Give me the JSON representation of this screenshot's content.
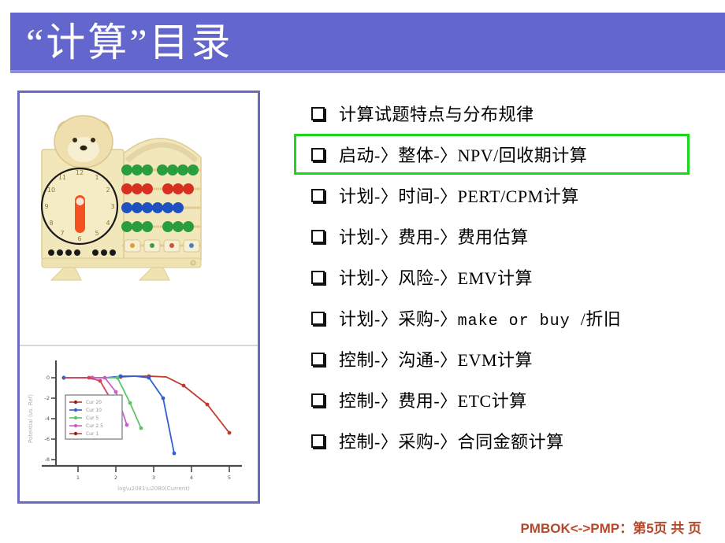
{
  "slide": {
    "title": "“计算”目录",
    "banner_color": "#6366cc",
    "highlight_color": "#19d819",
    "frame_color": "#6a6bc0"
  },
  "bullets": [
    {
      "label": "计算试题特点与分布规律",
      "highlighted": false
    },
    {
      "label": "启动-〉整体-〉NPV/回收期计算",
      "highlighted": true
    },
    {
      "label": "计划-〉时间-〉PERT/CPM计算",
      "highlighted": false
    },
    {
      "label": "计划-〉费用-〉费用估算",
      "highlighted": false
    },
    {
      "label": "计划-〉风险-〉EMV计算",
      "highlighted": false
    },
    {
      "label": "计划-〉采购-〉",
      "mono": "make or buy ",
      "label_tail": "/折旧",
      "highlighted": false
    },
    {
      "label": "控制-〉沟通-〉EVM计算",
      "highlighted": false
    },
    {
      "label": "控制-〉费用-〉ETC计算",
      "highlighted": false
    },
    {
      "label": "控制-〉采购-〉合同金额计算",
      "highlighted": false
    }
  ],
  "footer": {
    "text": "PMBOK<->PMP：第5页 共 页",
    "color": "#b5472a"
  },
  "left_photo": {
    "name": "wooden-bear-abacus-clock-toy",
    "description": "木制小熊时钟算盘玩具",
    "wood_color": "#f0e4b4",
    "bead_colors": [
      "#2a9d3f",
      "#d83020",
      "#1f52c0",
      "#2a9d3f"
    ],
    "clock_numbers": [
      "12",
      "1",
      "2",
      "3",
      "4",
      "5",
      "6",
      "7",
      "8",
      "9",
      "10",
      "11"
    ],
    "clock_hand_color": "#f4511e"
  },
  "chart_data": {
    "type": "line",
    "title": "",
    "xlabel": "log₁₀(Current)",
    "ylabel": "Potential (vs. Ref)",
    "xlim": [
      0,
      5
    ],
    "ylim": [
      -10,
      1
    ],
    "grid": false,
    "legend_position": "center-left",
    "series": [
      {
        "name": "Cur 20",
        "color": "#c0392b",
        "x": [
          0.2,
          0.6,
          1.0,
          1.4,
          1.8,
          2.2,
          2.6,
          3.0,
          3.4,
          3.9,
          4.4
        ],
        "values": [
          0.0,
          0.0,
          0.0,
          0.0,
          0.0,
          0.05,
          0.05,
          0.0,
          -0.8,
          -2.6,
          -5.8
        ]
      },
      {
        "name": "Cur 10",
        "color": "#2f5fd0",
        "x": [
          0.2,
          0.6,
          1.0,
          1.4,
          1.8,
          2.2,
          2.6,
          3.0,
          3.3
        ],
        "values": [
          0.0,
          0.0,
          0.0,
          0.0,
          0.05,
          0.05,
          0.0,
          -2.0,
          -7.4
        ]
      },
      {
        "name": "Cur 5",
        "color": "#5ec46a",
        "x": [
          0.2,
          0.6,
          1.0,
          1.4,
          1.8,
          2.1,
          2.4
        ],
        "values": [
          0.0,
          0.0,
          0.0,
          0.0,
          0.0,
          -2.4,
          -5.1
        ]
      },
      {
        "name": "Cur 2.5",
        "color": "#cc5ccc",
        "x": [
          0.2,
          0.6,
          1.0,
          1.4,
          1.7,
          1.9
        ],
        "values": [
          0.0,
          0.0,
          0.0,
          0.0,
          -1.4,
          -4.4
        ]
      },
      {
        "name": "Cur 1",
        "color": "#d0435c",
        "x": [
          0.2,
          0.6,
          1.0,
          1.3,
          1.5
        ],
        "values": [
          0.0,
          0.0,
          0.0,
          -0.6,
          -2.4
        ]
      }
    ]
  }
}
